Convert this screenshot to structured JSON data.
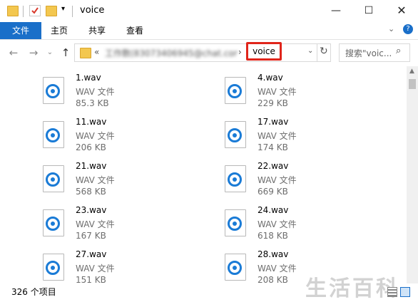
{
  "window": {
    "title": "voice"
  },
  "ribbon": {
    "tabs": [
      "文件",
      "主页",
      "共享",
      "查看"
    ]
  },
  "address": {
    "prefix": "«",
    "blurred_segment": "工作数(83073406945@chat.com)",
    "current": "voice"
  },
  "search": {
    "placeholder": "搜索\"voic..."
  },
  "files": [
    {
      "name": "1.wav",
      "type": "WAV 文件",
      "size": "85.3 KB"
    },
    {
      "name": "4.wav",
      "type": "WAV 文件",
      "size": "229 KB"
    },
    {
      "name": "11.wav",
      "type": "WAV 文件",
      "size": "206 KB"
    },
    {
      "name": "17.wav",
      "type": "WAV 文件",
      "size": "174 KB"
    },
    {
      "name": "21.wav",
      "type": "WAV 文件",
      "size": "568 KB"
    },
    {
      "name": "22.wav",
      "type": "WAV 文件",
      "size": "669 KB"
    },
    {
      "name": "23.wav",
      "type": "WAV 文件",
      "size": "167 KB"
    },
    {
      "name": "24.wav",
      "type": "WAV 文件",
      "size": "618 KB"
    },
    {
      "name": "27.wav",
      "type": "WAV 文件",
      "size": "151 KB"
    },
    {
      "name": "28.wav",
      "type": "WAV 文件",
      "size": "208 KB"
    }
  ],
  "status": {
    "item_count": "326 个项目"
  },
  "watermark": "生活百科",
  "colors": {
    "accent": "#1a6fc9",
    "highlight_box": "#e0251b",
    "icon_blue": "#1a7bd6"
  }
}
